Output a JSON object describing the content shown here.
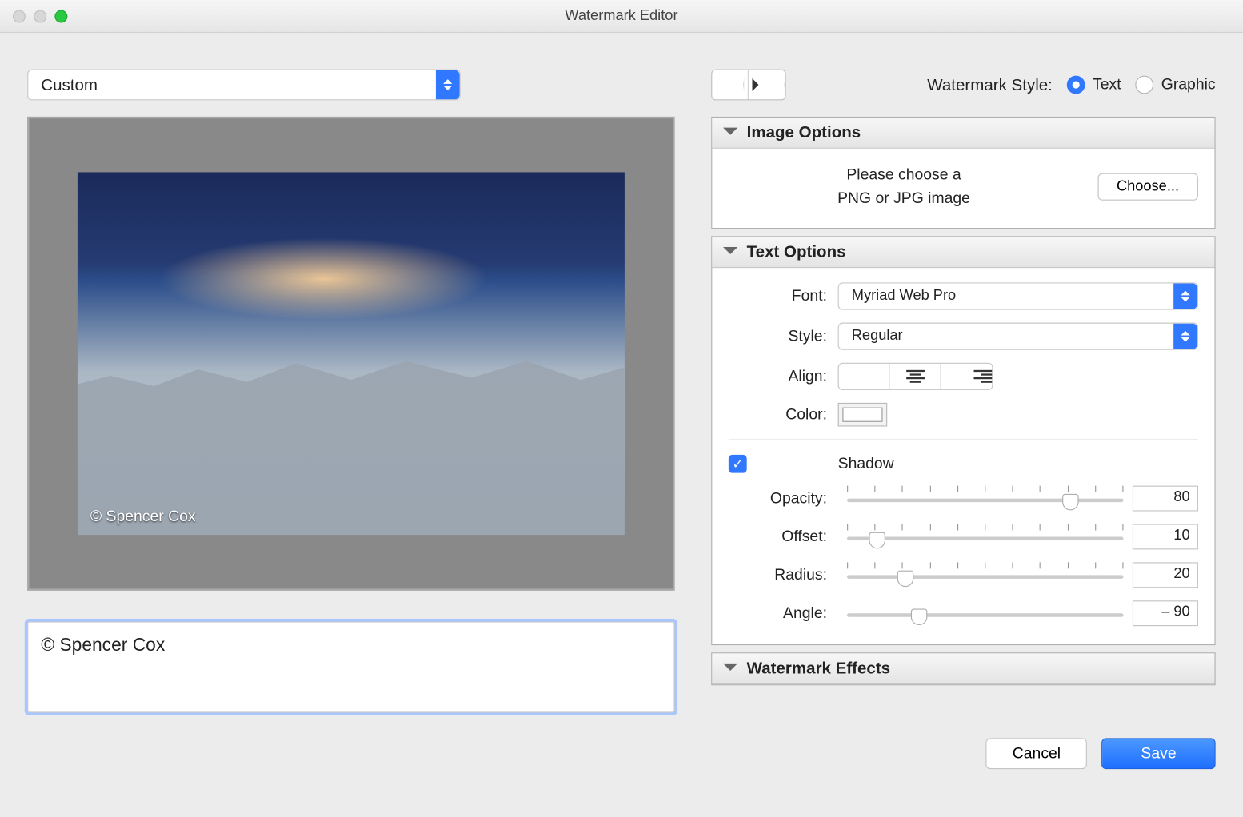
{
  "window": {
    "title": "Watermark Editor"
  },
  "preset": {
    "value": "Custom"
  },
  "watermark_style": {
    "label": "Watermark Style:",
    "text": "Text",
    "graphic": "Graphic",
    "selected": "text"
  },
  "panels": {
    "image_options": {
      "title": "Image Options",
      "prompt_line1": "Please choose a",
      "prompt_line2": "PNG or JPG image",
      "choose_label": "Choose..."
    },
    "text_options": {
      "title": "Text Options",
      "font_label": "Font:",
      "font_value": "Myriad Web Pro",
      "style_label": "Style:",
      "style_value": "Regular",
      "align_label": "Align:",
      "color_label": "Color:",
      "shadow_label": "Shadow",
      "opacity_label": "Opacity:",
      "opacity_value": "80",
      "offset_label": "Offset:",
      "offset_value": "10",
      "radius_label": "Radius:",
      "radius_value": "20",
      "angle_label": "Angle:",
      "angle_value": "– 90"
    },
    "watermark_effects": {
      "title": "Watermark Effects"
    }
  },
  "preview": {
    "watermark_sample": "© Spencer Cox"
  },
  "text_input": {
    "value": "© Spencer Cox"
  },
  "footer": {
    "cancel": "Cancel",
    "save": "Save"
  }
}
